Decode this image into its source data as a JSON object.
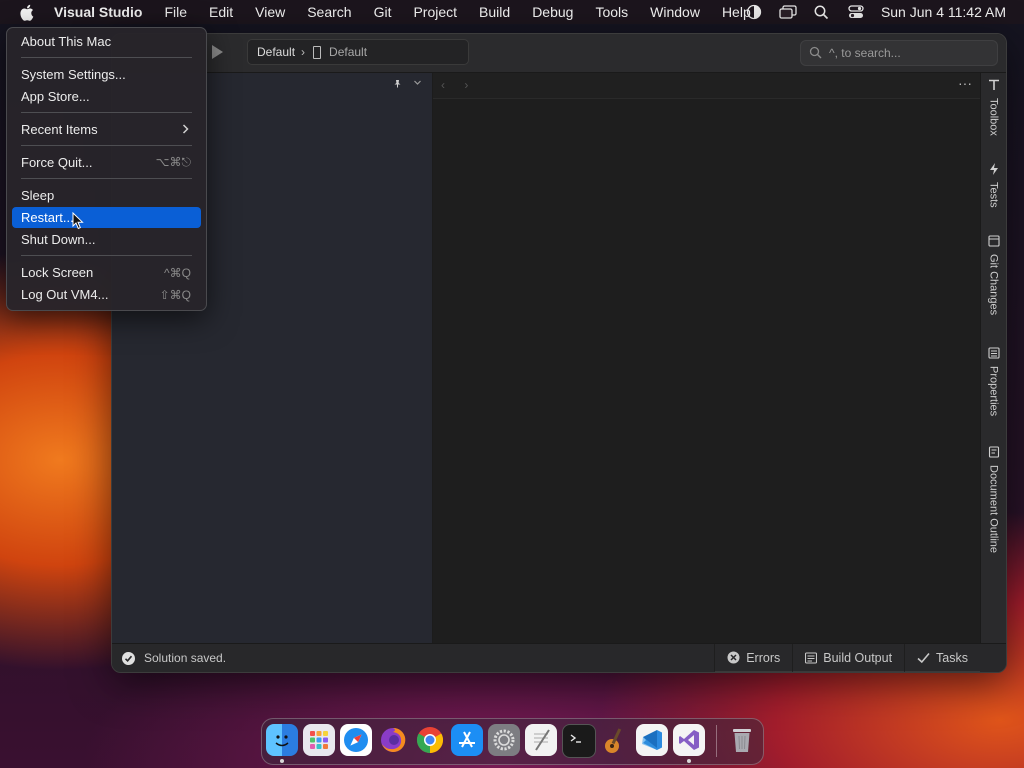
{
  "menubar": {
    "app_name": "Visual Studio",
    "menus": [
      "File",
      "Edit",
      "View",
      "Search",
      "Git",
      "Project",
      "Build",
      "Debug",
      "Tools",
      "Window",
      "Help"
    ],
    "clock": "Sun Jun 4  11:42 AM"
  },
  "apple_menu": {
    "about": "About This Mac",
    "system_settings": "System Settings...",
    "app_store": "App Store...",
    "recent_items": "Recent Items",
    "force_quit": "Force Quit...",
    "force_quit_shortcut": "⌥⌘⎋",
    "sleep": "Sleep",
    "restart": "Restart...",
    "shut_down": "Shut Down...",
    "lock_screen": "Lock Screen",
    "lock_screen_shortcut": "^⌘Q",
    "log_out": "Log Out VM4...",
    "log_out_shortcut": "⇧⌘Q",
    "highlighted": "restart"
  },
  "toolbar": {
    "config": "Default",
    "config_separator": "›",
    "device": "Default",
    "search_placeholder": "^, to search..."
  },
  "right_pads": {
    "toolbox": "Toolbox",
    "tests": "Tests",
    "git_changes": "Git Changes",
    "properties": "Properties",
    "document_outline": "Document Outline"
  },
  "editor": {
    "nav": "‹ ›",
    "more": "···"
  },
  "statusbar": {
    "status": "Solution saved.",
    "errors": "Errors",
    "build_output": "Build Output",
    "tasks": "Tasks"
  },
  "dock": {
    "apps": [
      "finder-icon",
      "launchpad-icon",
      "safari-icon",
      "firefox-icon",
      "chrome-icon",
      "app-store-icon",
      "system-settings-icon",
      "textedit-icon",
      "terminal-icon",
      "garageband-icon",
      "vscode-icon",
      "visual-studio-icon",
      "trash-icon"
    ]
  },
  "colors": {
    "menu_highlight": "#0a5fd6",
    "vs_purple": "#865fc5",
    "vscode_blue": "#2b8ae0"
  }
}
